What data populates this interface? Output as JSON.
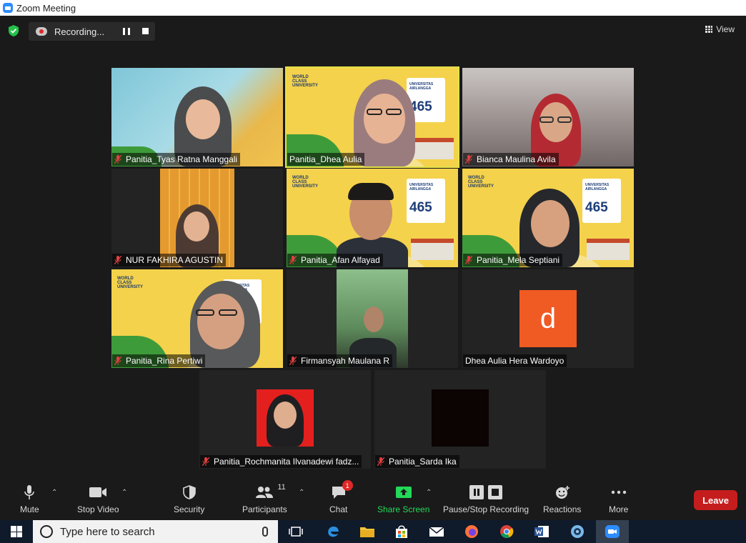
{
  "window": {
    "title": "Zoom Meeting"
  },
  "recording": {
    "label": "Recording..."
  },
  "view_button": {
    "label": "View"
  },
  "participants": [
    {
      "name": "Panitia_Tyas Ratna Manggali",
      "muted": true,
      "active": false
    },
    {
      "name": "Panitia_Dhea Aulia",
      "muted": false,
      "active": true
    },
    {
      "name": "Bianca Maulina Avila",
      "muted": true,
      "active": false
    },
    {
      "name": "NUR FAKHIRA AGUSTIN",
      "muted": true,
      "active": false
    },
    {
      "name": "Panitia_Afan Alfayad",
      "muted": true,
      "active": false
    },
    {
      "name": "Panitia_Mela Septiani",
      "muted": true,
      "active": false
    },
    {
      "name": "Panitia_Rina Pertiwi",
      "muted": true,
      "active": false
    },
    {
      "name": "Firmansyah Maulana R",
      "muted": true,
      "active": false
    },
    {
      "name": "Dhea Aulia Hera Wardoyo",
      "muted": false,
      "active": false,
      "avatar_letter": "d",
      "avatar_color": "#f05a23"
    },
    {
      "name": "Panitia_Rochmanita Ilvanadewi fadz...",
      "muted": true,
      "active": false
    },
    {
      "name": "Panitia_Sarda Ika",
      "muted": true,
      "active": false
    }
  ],
  "virtual_background": {
    "brand": "WORLD CLASS UNIVERSITY",
    "university": "UNIVERSITAS AIRLANGGA",
    "rank": "465"
  },
  "toolbar": {
    "mute": "Mute",
    "stop_video": "Stop Video",
    "security": "Security",
    "participants": "Participants",
    "participants_count": "11",
    "chat": "Chat",
    "chat_badge": "1",
    "share_screen": "Share Screen",
    "pause_stop_recording": "Pause/Stop Recording",
    "reactions": "Reactions",
    "more": "More",
    "leave": "Leave"
  },
  "taskbar": {
    "search_placeholder": "Type here to search"
  },
  "colors": {
    "accent_blue": "#2d8cff",
    "leave_red": "#c51d1d",
    "share_green": "#23d959",
    "active_speaker": "#e5e048"
  }
}
